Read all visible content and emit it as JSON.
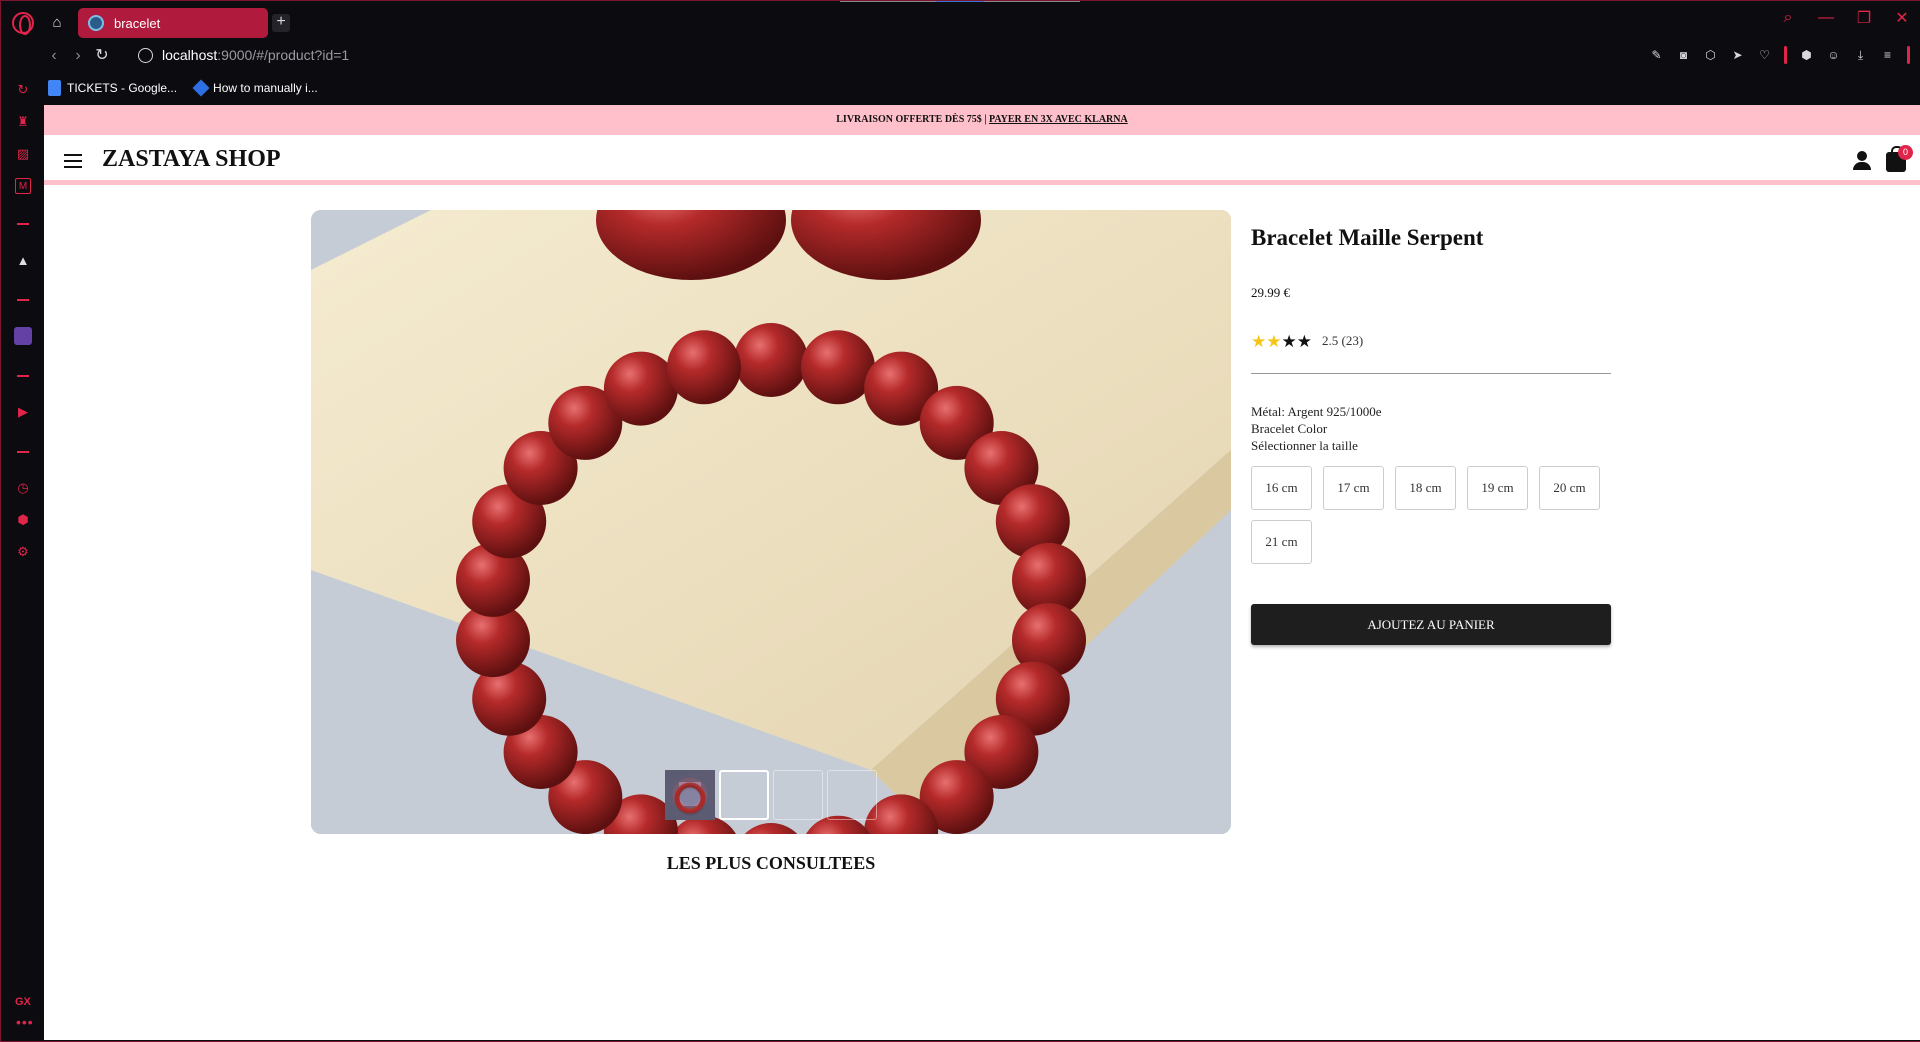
{
  "browser": {
    "tab_title": "bracelet",
    "url_host": "localhost",
    "url_path": ":9000/#/product?id=1",
    "bookmarks": [
      {
        "label": "TICKETS - Google...",
        "icon": "google-docs-icon"
      },
      {
        "label": "How to manually i...",
        "icon": "jira-icon"
      }
    ],
    "accent": "#e0244a"
  },
  "store": {
    "promo_text": "LIVRAISON OFFERTE DÈS 75$ | ",
    "promo_link": "PAYER EN 3X AVEC KLARNA",
    "promo_bg": "#ffc0cb",
    "logo": "ZASTAYA SHOP",
    "cart_count": "0"
  },
  "product": {
    "title": "Bracelet Maille Serpent",
    "price": "29.99 €",
    "rating_value": 2.5,
    "rating_text": "2.5 (23)",
    "metal": "Métal: Argent 925/1000e",
    "color_label": "Bracelet Color",
    "size_label": "Sélectionner la taille",
    "sizes": [
      "16 cm",
      "17 cm",
      "18 cm",
      "19 cm",
      "20 cm",
      "21 cm"
    ],
    "add_to_cart": "AJOUTEZ AU PANIER",
    "thumbnail_count": 4,
    "active_thumbnail": 2
  },
  "sections": {
    "most_viewed": "LES PLUS CONSULTEES"
  }
}
